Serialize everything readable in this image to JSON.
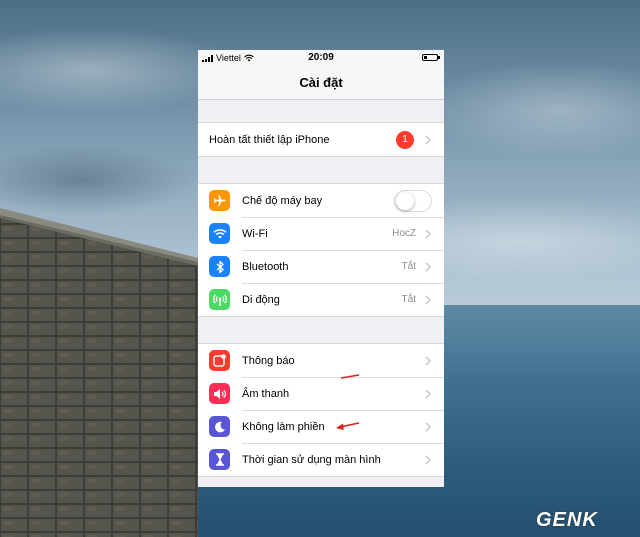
{
  "status_bar": {
    "carrier": "Viettel",
    "time": "20:09"
  },
  "nav": {
    "title": "Cài đặt"
  },
  "setup_group": {
    "label": "Hoàn tất thiết lập iPhone",
    "badge": "1"
  },
  "connectivity_group": [
    {
      "label": "Chế độ máy bay",
      "icon": "airplane-icon",
      "color": "#ff9500",
      "toggle_on": false
    },
    {
      "label": "Wi-Fi",
      "icon": "wifi-icon",
      "color": "#1a82fb",
      "value": "HocZ"
    },
    {
      "label": "Bluetooth",
      "icon": "bluetooth-icon",
      "color": "#1a82fb",
      "value": "Tắt"
    },
    {
      "label": "Di động",
      "icon": "cellular-icon",
      "color": "#4cd964",
      "value": "Tắt"
    }
  ],
  "notifications_group": [
    {
      "label": "Thông báo",
      "icon": "notifications-icon",
      "color": "#ff3b30"
    },
    {
      "label": "Âm thanh",
      "icon": "sound-icon",
      "color": "#ff2d55"
    },
    {
      "label": "Không làm phiền",
      "icon": "moon-icon",
      "color": "#5856d6"
    },
    {
      "label": "Thời gian sử dụng màn hình",
      "icon": "hourglass-icon",
      "color": "#5856d6"
    }
  ],
  "watermark": "GENK"
}
